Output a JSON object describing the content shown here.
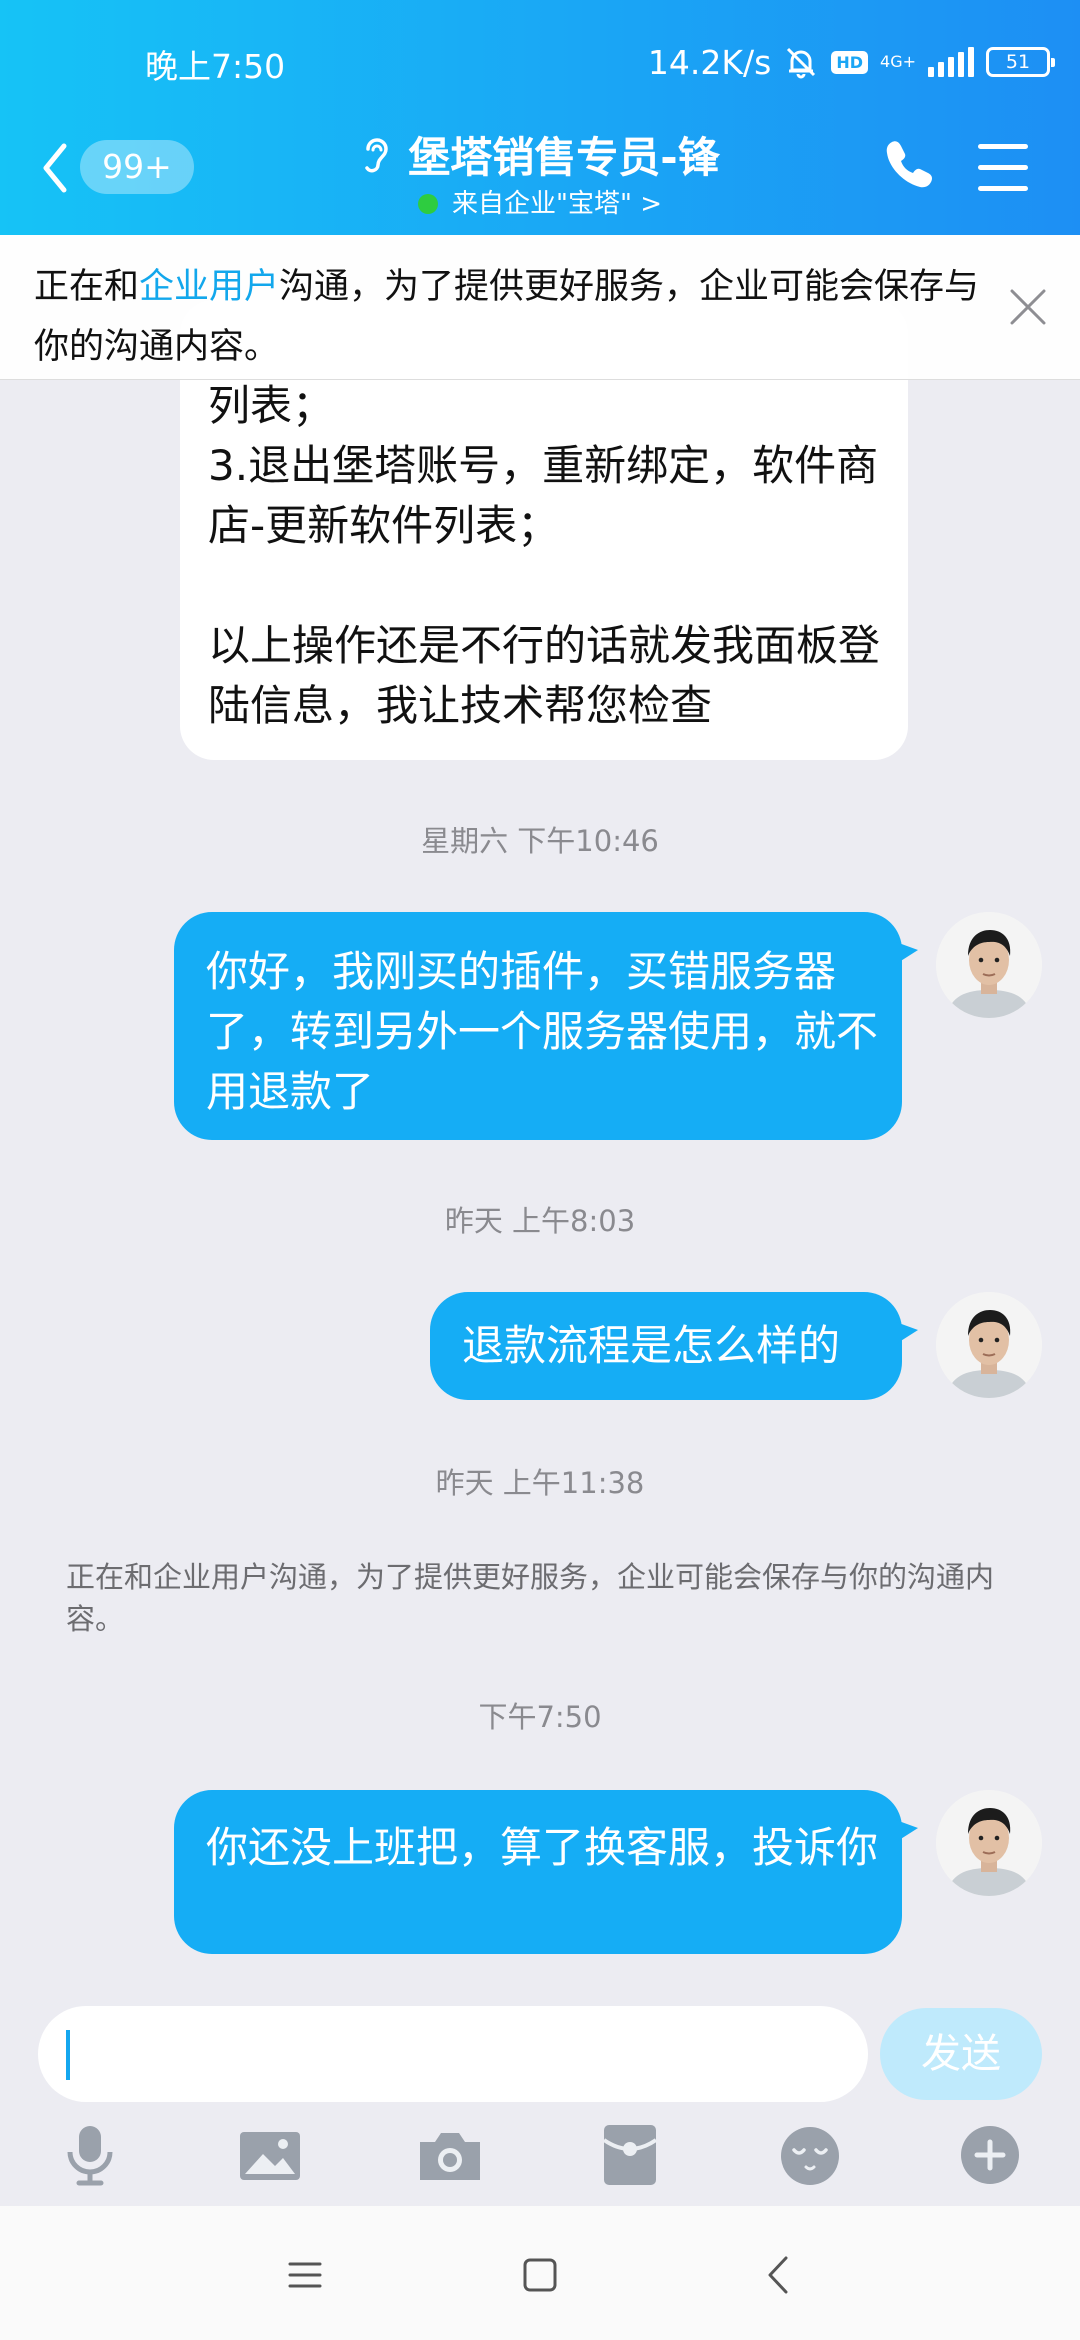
{
  "status_bar": {
    "time": "晚上7:50",
    "net_speed": "14.2K/s",
    "hd": "HD",
    "network": "4G+",
    "battery": "51"
  },
  "header": {
    "unread_count": "99+",
    "title": "堡塔销售专员-锋",
    "subtitle": "来自企业\"宝塔\" >"
  },
  "notice": {
    "before": "正在和",
    "highlight": "企业用户",
    "after": "沟通，为了提供更好服务，企业可能会保存与你的沟通内容。"
  },
  "messages": {
    "incoming_1": "列表；\n3.退出堡塔账号，重新绑定，软件商店-更新软件列表；\n\n以上操作还是不行的话就发我面板登陆信息，我让技术帮您检查",
    "ts_1": "星期六 下午10:46",
    "out_1": "你好，我刚买的插件，买错服务器了，转到另外一个服务器使用，就不用退款了",
    "ts_2": "昨天 上午8:03",
    "out_2": "退款流程是怎么样的",
    "ts_3": "昨天 上午11:38",
    "system_notice": "正在和企业用户沟通，为了提供更好服务，企业可能会保存与你的沟通内容。",
    "ts_4": "下午7:50",
    "out_3": "你还没上班把，算了换客服，投诉你"
  },
  "input": {
    "value": "",
    "send_label": "发送"
  },
  "colors": {
    "accent": "#15adf5",
    "send_disabled": "#bfeafc",
    "background": "#ececf2"
  },
  "toolbar_icons": [
    "microphone-icon",
    "image-icon",
    "camera-icon",
    "red-packet-icon",
    "emoji-icon",
    "plus-icon"
  ]
}
